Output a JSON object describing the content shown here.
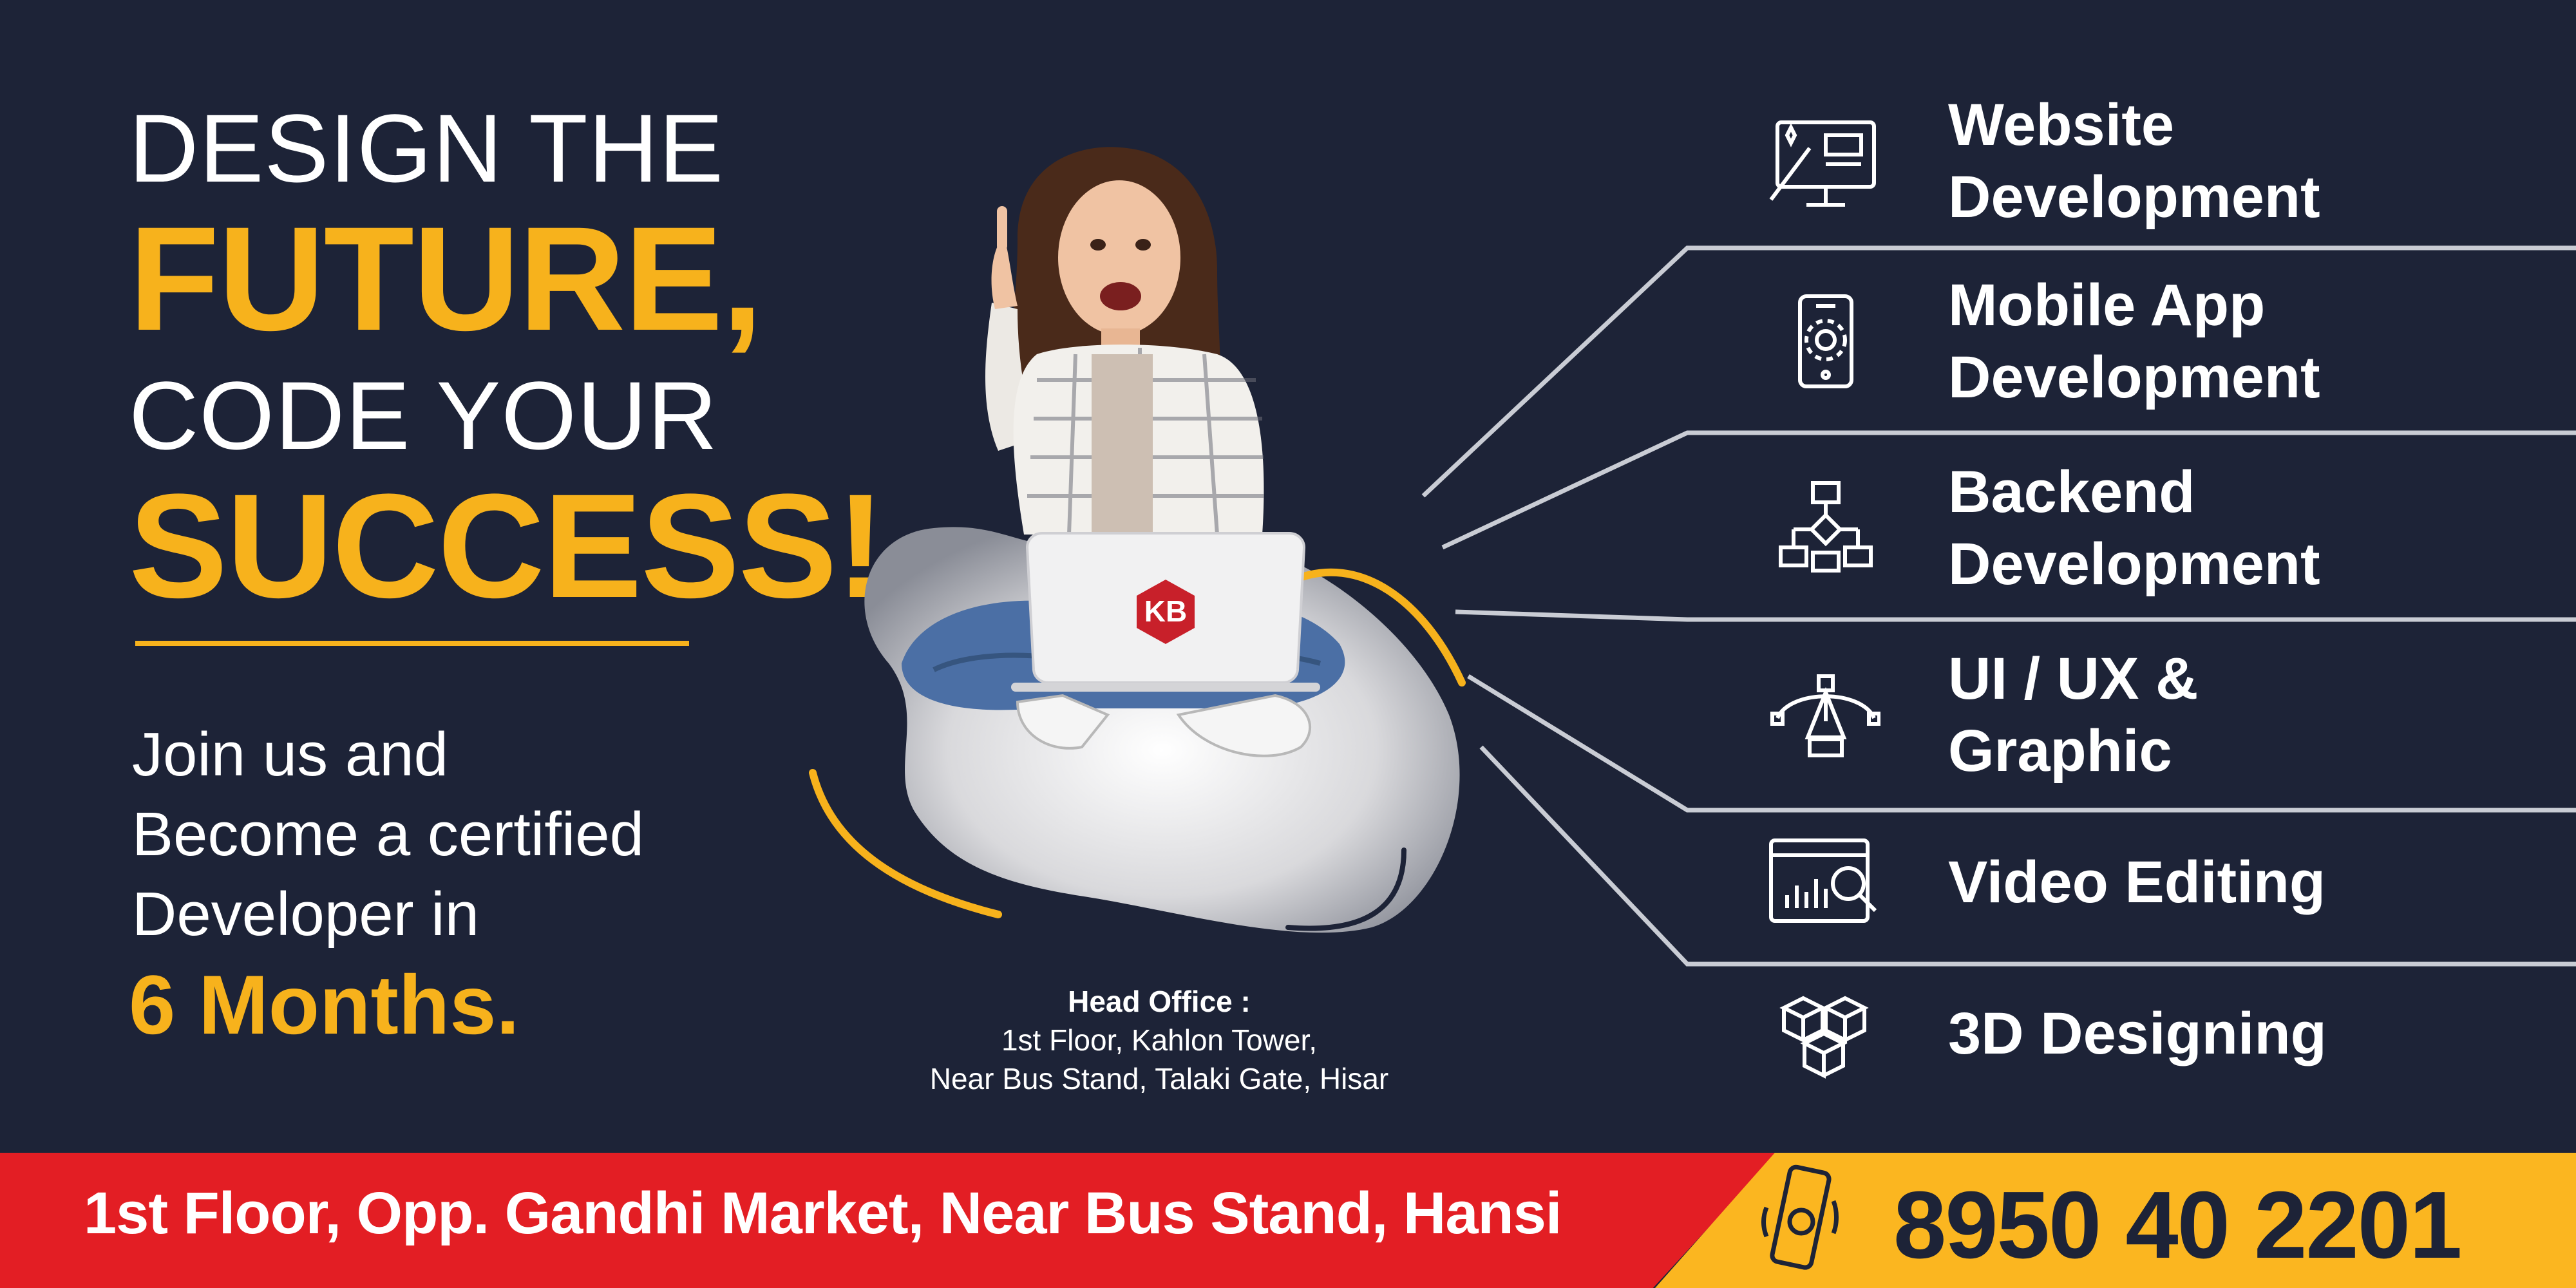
{
  "headline": {
    "line1": "DESIGN THE",
    "line2": "FUTURE,",
    "line3": "CODE YOUR",
    "line4": "SUCCESS!"
  },
  "tagline": {
    "line1": "Join us and",
    "line2": "Become a certified",
    "line3": "Developer in",
    "highlight": "6 Months."
  },
  "laptop_logo": "KB",
  "head_office": {
    "label": "Head Office :",
    "line1": "1st Floor, Kahlon Tower,",
    "line2": "Near Bus Stand, Talaki Gate, Hisar"
  },
  "services": [
    {
      "line1": "Website",
      "line2": "Development",
      "icon": "web-design-monitor-icon"
    },
    {
      "line1": "Mobile App",
      "line2": "Development",
      "icon": "mobile-gear-icon"
    },
    {
      "line1": "Backend",
      "line2": "Development",
      "icon": "flowchart-icon"
    },
    {
      "line1": "UI / UX &",
      "line2": "Graphic",
      "icon": "pen-tool-icon"
    },
    {
      "line1": "Video Editing",
      "line2": "",
      "icon": "analytics-search-icon"
    },
    {
      "line1": "3D Designing",
      "line2": "",
      "icon": "3d-cubes-icon"
    }
  ],
  "footer": {
    "address": "1st Floor, Opp. Gandhi Market, Near Bus Stand, Hansi",
    "phone": "8950 40 2201",
    "phone_icon": "phone-icon"
  },
  "colors": {
    "background": "#1d2337",
    "accent_yellow": "#f7b21c",
    "footer_red": "#e31e24",
    "footer_yellow": "#fbb620"
  }
}
